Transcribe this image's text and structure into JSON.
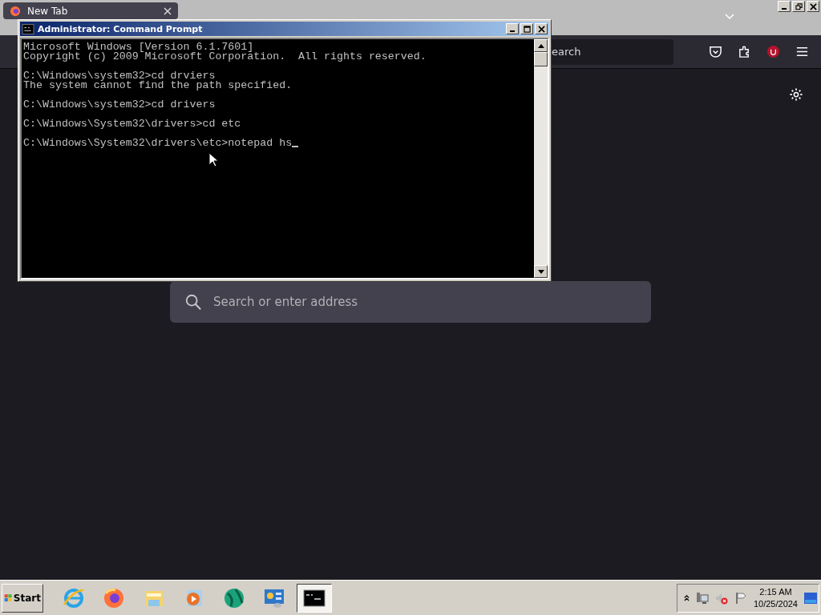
{
  "browser": {
    "tab": {
      "title": "New Tab"
    },
    "address_bar": {
      "placeholder": "earch"
    },
    "search": {
      "placeholder": "Search or enter address"
    }
  },
  "console": {
    "title": "Administrator: Command Prompt",
    "blocks": [
      [
        "Microsoft Windows [Version 6.1.7601]",
        "Copyright (c) 2009 Microsoft Corporation.  All rights reserved."
      ],
      [
        "C:\\Windows\\system32>cd drviers",
        "The system cannot find the path specified."
      ],
      [
        "C:\\Windows\\system32>cd drivers"
      ],
      [
        "C:\\Windows\\System32\\drivers>cd etc"
      ],
      [
        "C:\\Windows\\System32\\drivers\\etc>notepad hs"
      ]
    ]
  },
  "taskbar": {
    "start": "Start",
    "apps": [
      {
        "kind": "browser",
        "selected": false
      },
      {
        "kind": "firefox",
        "selected": false
      },
      {
        "kind": "folder",
        "selected": false
      },
      {
        "kind": "media",
        "selected": false
      },
      {
        "kind": "globe",
        "selected": false
      },
      {
        "kind": "panel",
        "selected": false
      },
      {
        "kind": "terminal",
        "selected": true
      }
    ],
    "clock": {
      "time": "2:15 AM",
      "date": "10/25/2024"
    }
  }
}
